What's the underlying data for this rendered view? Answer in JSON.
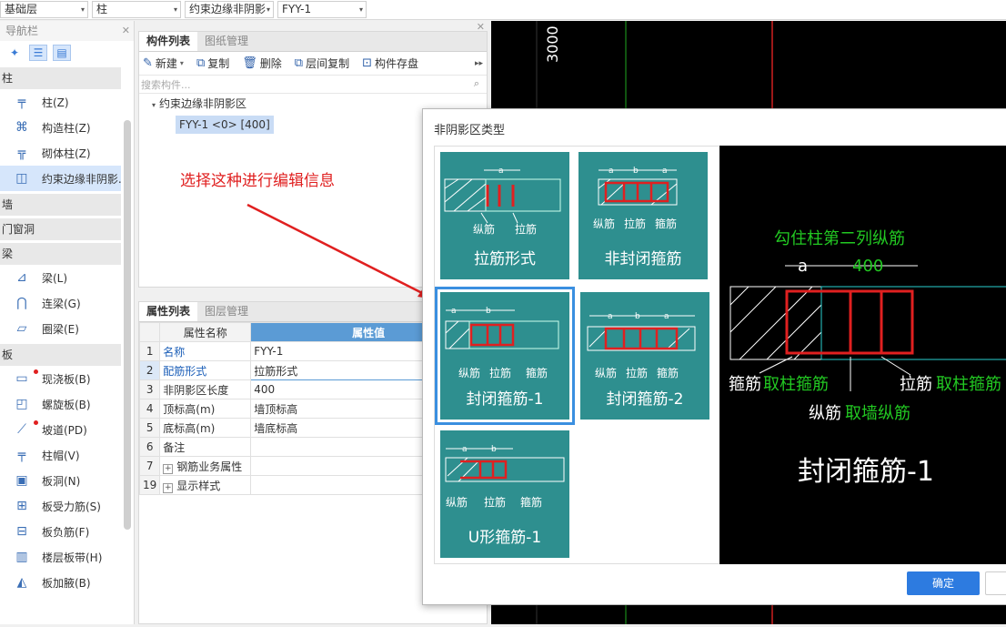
{
  "topbar": {
    "floor": "基础层",
    "category": "柱",
    "type": "约束边缘非阴影",
    "component": "FYY-1"
  },
  "nav": {
    "title": "导航栏",
    "categories": {
      "zhu": "柱",
      "qiang": "墙",
      "menchuang": "门窗洞",
      "liang": "梁",
      "ban": "板"
    },
    "zhu_items": [
      "柱(Z)",
      "构造柱(Z)",
      "砌体柱(Z)",
      "约束边缘非阴影."
    ],
    "liang_items": [
      "梁(L)",
      "连梁(G)",
      "圈梁(E)"
    ],
    "ban_items": [
      "现浇板(B)",
      "螺旋板(B)",
      "坡道(PD)",
      "柱帽(V)",
      "板洞(N)",
      "板受力筋(S)",
      "板负筋(F)",
      "楼层板带(H)",
      "板加腋(B)"
    ]
  },
  "component_panel": {
    "tabs": [
      "构件列表",
      "图纸管理"
    ],
    "toolbar": {
      "new": "新建",
      "copy": "复制",
      "delete": "删除",
      "floor_copy": "层间复制",
      "save": "构件存盘"
    },
    "search_placeholder": "搜索构件...",
    "tree_root": "约束边缘非阴影区",
    "tree_child": "FYY-1 <0> [400]"
  },
  "property_panel": {
    "tabs": [
      "属性列表",
      "图层管理"
    ],
    "header_name": "属性名称",
    "header_value": "属性值",
    "rows": [
      {
        "n": "1",
        "k": "名称",
        "v": "FYY-1"
      },
      {
        "n": "2",
        "k": "配筋形式",
        "v": "拉筋形式"
      },
      {
        "n": "3",
        "k": "非阴影区长度",
        "v": "400"
      },
      {
        "n": "4",
        "k": "顶标高(m)",
        "v": "墙顶标高"
      },
      {
        "n": "5",
        "k": "底标高(m)",
        "v": "墙底标高"
      },
      {
        "n": "6",
        "k": "备注",
        "v": ""
      },
      {
        "n": "7",
        "k": "钢筋业务属性",
        "v": ""
      },
      {
        "n": "19",
        "k": "显示样式",
        "v": ""
      }
    ]
  },
  "cad": {
    "dim_top": "3000"
  },
  "annotation": "选择这种进行编辑信息",
  "dialog": {
    "title": "非阴影区类型",
    "cards": [
      {
        "caption": "拉筋形式",
        "labels": [
          "纵筋",
          "拉筋"
        ],
        "dim": [
          "a"
        ]
      },
      {
        "caption": "非封闭箍筋",
        "labels": [
          "纵筋",
          "拉筋",
          "箍筋"
        ],
        "dim": [
          "a",
          "b",
          "a"
        ]
      },
      {
        "caption": "封闭箍筋-1",
        "labels": [
          "纵筋",
          "拉筋",
          "箍筋"
        ],
        "dim": [
          "a",
          "b"
        ]
      },
      {
        "caption": "封闭箍筋-2",
        "labels": [
          "纵筋",
          "拉筋",
          "箍筋"
        ],
        "dim": [
          "a",
          "b",
          "a"
        ]
      },
      {
        "caption": "U形箍筋-1",
        "labels": [
          "纵筋",
          "拉筋",
          "箍筋"
        ],
        "dim": [
          "a",
          "b"
        ]
      }
    ],
    "preview": {
      "top_note": "勾住柱第二列纵筋",
      "dim_a": "a",
      "dim_400": "400",
      "label_gujin": "箍筋",
      "label_gujin_take": "取柱箍筋",
      "label_lajin": "拉筋",
      "label_lajin_take": "取柱箍筋",
      "label_zongjin": "纵筋",
      "label_zongjin_take": "取墙纵筋",
      "title": "封闭箍筋-1"
    },
    "ok": "确定"
  }
}
